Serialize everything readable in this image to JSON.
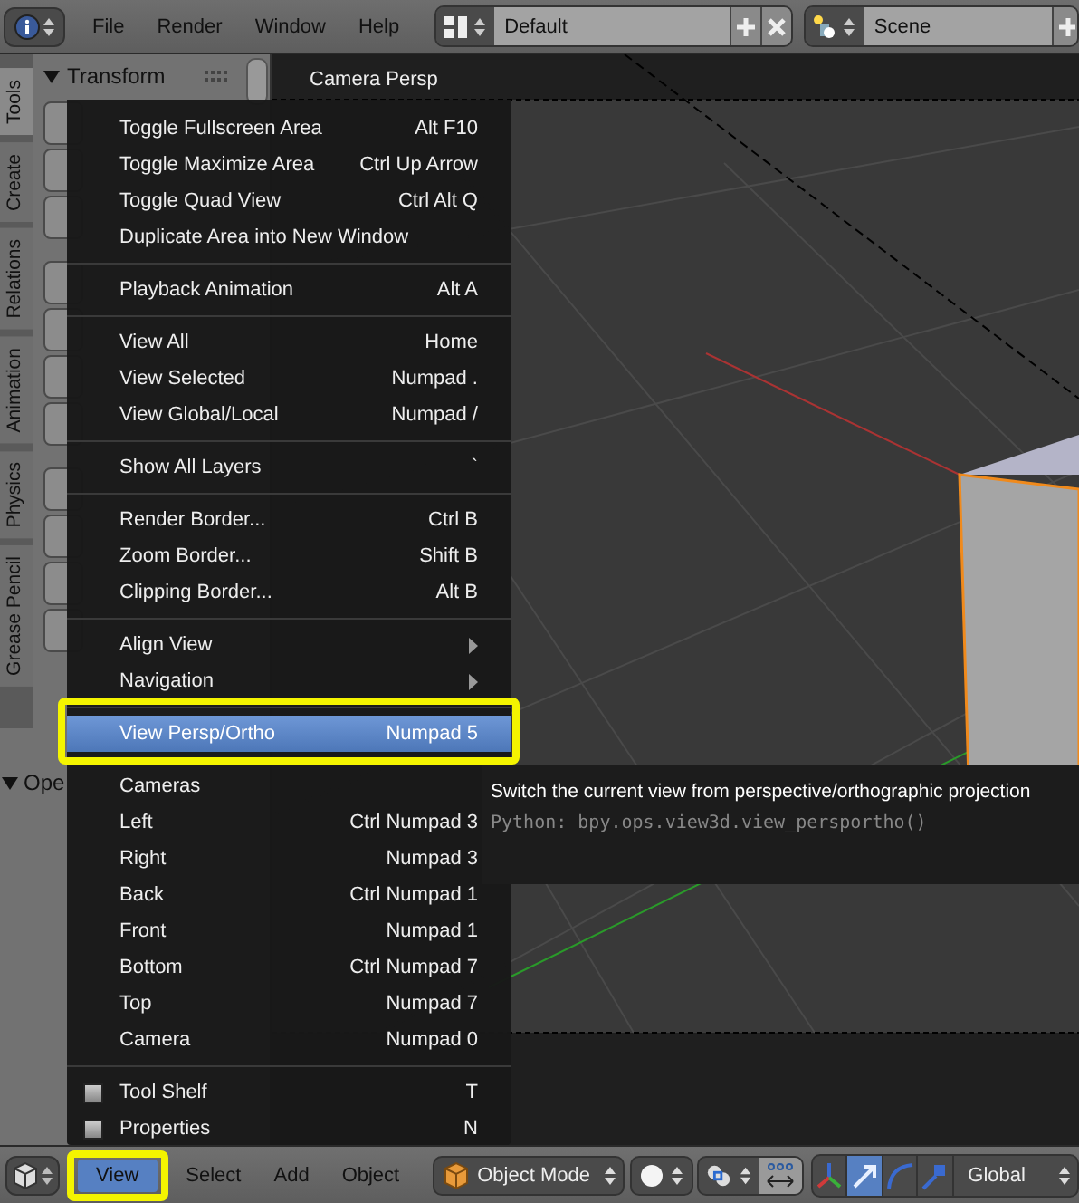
{
  "top_bar": {
    "menus": [
      "File",
      "Render",
      "Window",
      "Help"
    ],
    "screen_layout": "Default",
    "scene": "Scene"
  },
  "tool_shelf": {
    "tabs": [
      {
        "label": "Tools",
        "selected": true
      },
      {
        "label": "Create",
        "selected": false
      },
      {
        "label": "Relations",
        "selected": false
      },
      {
        "label": "Animation",
        "selected": false
      },
      {
        "label": "Physics",
        "selected": false
      },
      {
        "label": "Grease Pencil",
        "selected": false
      }
    ],
    "panels": [
      {
        "title": "Transform",
        "expanded": true
      },
      {
        "title": "Ope",
        "expanded": true
      }
    ]
  },
  "viewport": {
    "title": "Camera Persp"
  },
  "view_menu": {
    "items": [
      {
        "kind": "item",
        "label": "Toggle Fullscreen Area",
        "shortcut": "Alt F10",
        "selected": false
      },
      {
        "kind": "item",
        "label": "Toggle Maximize Area",
        "shortcut": "Ctrl Up Arrow",
        "selected": false
      },
      {
        "kind": "item",
        "label": "Toggle Quad View",
        "shortcut": "Ctrl Alt Q",
        "selected": false
      },
      {
        "kind": "item",
        "label": "Duplicate Area into New Window",
        "selected": false
      },
      {
        "kind": "separator"
      },
      {
        "kind": "item",
        "label": "Playback Animation",
        "shortcut": "Alt A",
        "selected": false
      },
      {
        "kind": "separator"
      },
      {
        "kind": "item",
        "label": "View All",
        "shortcut": "Home",
        "selected": false
      },
      {
        "kind": "item",
        "label": "View Selected",
        "shortcut": "Numpad .",
        "selected": false
      },
      {
        "kind": "item",
        "label": "View Global/Local",
        "shortcut": "Numpad /",
        "selected": false
      },
      {
        "kind": "separator"
      },
      {
        "kind": "item",
        "label": "Show All Layers",
        "shortcut": "`",
        "selected": false
      },
      {
        "kind": "separator"
      },
      {
        "kind": "item",
        "label": "Render Border...",
        "shortcut": "Ctrl B",
        "selected": false
      },
      {
        "kind": "item",
        "label": "Zoom Border...",
        "shortcut": "Shift B",
        "selected": false
      },
      {
        "kind": "item",
        "label": "Clipping Border...",
        "shortcut": "Alt B",
        "selected": false
      },
      {
        "kind": "separator"
      },
      {
        "kind": "submenu",
        "label": "Align View",
        "selected": false
      },
      {
        "kind": "submenu",
        "label": "Navigation",
        "selected": false
      },
      {
        "kind": "separator"
      },
      {
        "kind": "item",
        "label": "View Persp/Ortho",
        "shortcut": "Numpad 5",
        "selected": true
      },
      {
        "kind": "separator"
      },
      {
        "kind": "item",
        "label": "Cameras",
        "selected": false
      },
      {
        "kind": "item",
        "label": "Left",
        "shortcut": "Ctrl Numpad 3",
        "selected": false
      },
      {
        "kind": "item",
        "label": "Right",
        "shortcut": "Numpad 3",
        "selected": false
      },
      {
        "kind": "item",
        "label": "Back",
        "shortcut": "Ctrl Numpad 1",
        "selected": false
      },
      {
        "kind": "item",
        "label": "Front",
        "shortcut": "Numpad 1",
        "selected": false
      },
      {
        "kind": "item",
        "label": "Bottom",
        "shortcut": "Ctrl Numpad 7",
        "selected": false
      },
      {
        "kind": "item",
        "label": "Top",
        "shortcut": "Numpad 7",
        "selected": false
      },
      {
        "kind": "item",
        "label": "Camera",
        "shortcut": "Numpad 0",
        "selected": false
      },
      {
        "kind": "separator"
      },
      {
        "kind": "checkbox",
        "label": "Tool Shelf",
        "shortcut": "T",
        "checked": false,
        "selected": false
      },
      {
        "kind": "checkbox",
        "label": "Properties",
        "shortcut": "N",
        "checked": false,
        "selected": false
      }
    ]
  },
  "tooltip": {
    "text": "Switch the current view from perspective/orthographic projection",
    "python": "Python: bpy.ops.view3d.view_persportho()"
  },
  "header": {
    "menus": [
      {
        "label": "View",
        "selected": true
      },
      {
        "label": "Select",
        "selected": false
      },
      {
        "label": "Add",
        "selected": false
      },
      {
        "label": "Object",
        "selected": false
      }
    ],
    "mode": "Object Mode",
    "orientation": "Global"
  }
}
